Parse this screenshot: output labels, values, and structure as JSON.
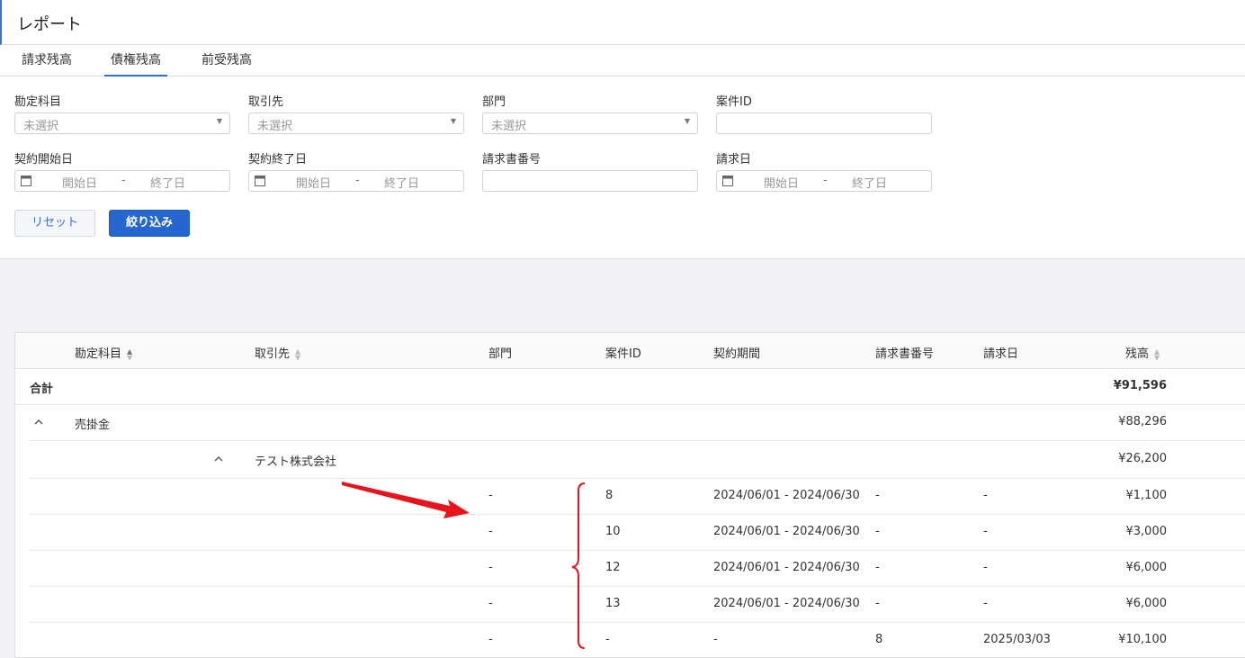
{
  "header": {
    "title": "レポート"
  },
  "tabs": [
    {
      "label": "請求残高"
    },
    {
      "label": "債権残高"
    },
    {
      "label": "前受残高"
    }
  ],
  "filters": {
    "account": {
      "label": "勘定科目",
      "placeholder": "未選択"
    },
    "partner": {
      "label": "取引先",
      "placeholder": "未選択"
    },
    "department": {
      "label": "部門",
      "placeholder": "未選択"
    },
    "project_id": {
      "label": "案件ID",
      "value": ""
    },
    "contract_start": {
      "label": "契約開始日",
      "start_placeholder": "開始日",
      "end_placeholder": "終了日"
    },
    "contract_end": {
      "label": "契約終了日",
      "start_placeholder": "開始日",
      "end_placeholder": "終了日"
    },
    "invoice_no": {
      "label": "請求書番号",
      "value": ""
    },
    "invoice_date": {
      "label": "請求日",
      "start_placeholder": "開始日",
      "end_placeholder": "終了日"
    },
    "range_separator": "-"
  },
  "buttons": {
    "reset": "リセット",
    "apply": "絞り込み"
  },
  "table": {
    "columns": [
      "勘定科目",
      "取引先",
      "部門",
      "案件ID",
      "契約期間",
      "請求書番号",
      "請求日",
      "残高"
    ],
    "total": {
      "label": "合計",
      "balance": "¥91,596"
    },
    "group": {
      "account": "売掛金",
      "balance": "¥88,296"
    },
    "subgroup": {
      "partner": "テスト株式会社",
      "balance": "¥26,200"
    },
    "rows": [
      {
        "department": "-",
        "project_id": "8",
        "period": "2024/06/01 - 2024/06/30",
        "invoice_no": "-",
        "invoice_date": "-",
        "balance": "¥1,100"
      },
      {
        "department": "-",
        "project_id": "10",
        "period": "2024/06/01 - 2024/06/30",
        "invoice_no": "-",
        "invoice_date": "-",
        "balance": "¥3,000"
      },
      {
        "department": "-",
        "project_id": "12",
        "period": "2024/06/01 - 2024/06/30",
        "invoice_no": "-",
        "invoice_date": "-",
        "balance": "¥6,000"
      },
      {
        "department": "-",
        "project_id": "13",
        "period": "2024/06/01 - 2024/06/30",
        "invoice_no": "-",
        "invoice_date": "-",
        "balance": "¥6,000"
      },
      {
        "department": "-",
        "project_id": "-",
        "period": "-",
        "invoice_no": "8",
        "invoice_date": "2025/03/03",
        "balance": "¥10,100"
      }
    ]
  },
  "annotation_color": "#e8141b"
}
